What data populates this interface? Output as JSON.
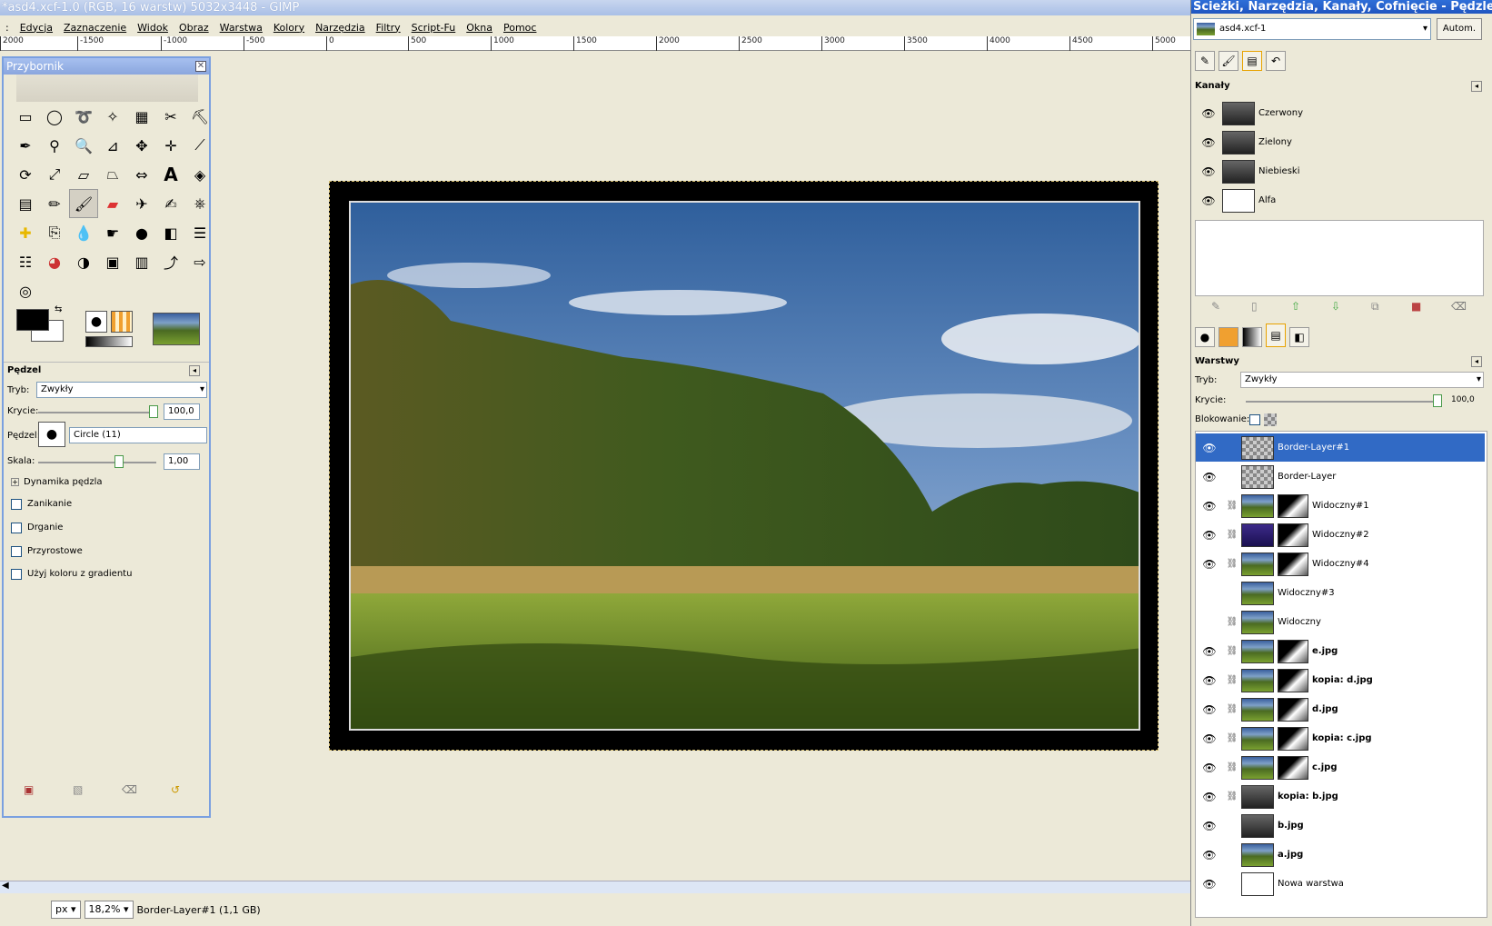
{
  "window": {
    "title": "*asd4.xcf-1.0 (RGB, 16 warstw) 5032x3448 - GIMP"
  },
  "menu": [
    "Edycja",
    "Zaznaczenie",
    "Widok",
    "Obraz",
    "Warstwa",
    "Kolory",
    "Narzędzia",
    "Filtry",
    "Script-Fu",
    "Okna",
    "Pomoc"
  ],
  "ruler": [
    "2000",
    "-1500",
    "-1000",
    "-500",
    "0",
    "500",
    "1000",
    "1500",
    "2000",
    "2500",
    "3000",
    "3500",
    "4000",
    "4500",
    "5000"
  ],
  "status": {
    "unit": "px",
    "zoom": "18,2%",
    "layer_info": "Border-Layer#1 (1,1 GB)"
  },
  "toolbox": {
    "title": "Przybornik",
    "tool_options_title": "Pędzel",
    "mode_label": "Tryb:",
    "mode_value": "Zwykły",
    "opacity_label": "Krycie:",
    "opacity_value": "100,0",
    "brush_label": "Pędzel:",
    "brush_value": "Circle (11)",
    "scale_label": "Skala:",
    "scale_value": "1,00",
    "dynamics_label": "Dynamika pędzla",
    "options": [
      "Zanikanie",
      "Drganie",
      "Przyrostowe",
      "Użyj koloru z gradientu"
    ]
  },
  "dock": {
    "title": "Ścieżki, Narzędzia, Kanały, Cofnięcie - Pędzle, Desenie...",
    "image_select": "asd4.xcf-1",
    "auto_button": "Autom.",
    "channels_title": "Kanały",
    "channels": [
      "Czerwony",
      "Zielony",
      "Niebieski",
      "Alfa"
    ],
    "layers_title": "Warstwy",
    "mode_label": "Tryb:",
    "mode_value": "Zwykły",
    "opacity_label": "Krycie:",
    "opacity_value": "100,0",
    "lock_label": "Blokowanie:",
    "layers": [
      {
        "name": "Border-Layer#1",
        "eye": true,
        "chain": false,
        "thumb": "chk",
        "mask": false,
        "bold": false
      },
      {
        "name": "Border-Layer",
        "eye": true,
        "chain": false,
        "thumb": "chk",
        "mask": false,
        "bold": false
      },
      {
        "name": "Widoczny#1",
        "eye": true,
        "chain": true,
        "thumb": "land",
        "mask": true,
        "bold": false
      },
      {
        "name": "Widoczny#2",
        "eye": true,
        "chain": true,
        "thumb": "purple",
        "mask": true,
        "bold": false
      },
      {
        "name": "Widoczny#4",
        "eye": true,
        "chain": true,
        "thumb": "land",
        "mask": true,
        "bold": false
      },
      {
        "name": "Widoczny#3",
        "eye": false,
        "chain": false,
        "thumb": "land",
        "mask": false,
        "bold": false
      },
      {
        "name": "Widoczny",
        "eye": false,
        "chain": true,
        "thumb": "land",
        "mask": false,
        "bold": false
      },
      {
        "name": "e.jpg",
        "eye": true,
        "chain": true,
        "thumb": "land",
        "mask": true,
        "bold": true
      },
      {
        "name": "kopia: d.jpg",
        "eye": true,
        "chain": true,
        "thumb": "land",
        "mask": true,
        "bold": true
      },
      {
        "name": "d.jpg",
        "eye": true,
        "chain": true,
        "thumb": "land",
        "mask": true,
        "bold": true
      },
      {
        "name": "kopia: c.jpg",
        "eye": true,
        "chain": true,
        "thumb": "land",
        "mask": true,
        "bold": true
      },
      {
        "name": "c.jpg",
        "eye": true,
        "chain": true,
        "thumb": "land",
        "mask": true,
        "bold": true
      },
      {
        "name": "kopia: b.jpg",
        "eye": true,
        "chain": true,
        "thumb": "gray",
        "mask": false,
        "bold": true
      },
      {
        "name": "b.jpg",
        "eye": true,
        "chain": false,
        "thumb": "gray",
        "mask": false,
        "bold": true
      },
      {
        "name": "a.jpg",
        "eye": true,
        "chain": false,
        "thumb": "land",
        "mask": false,
        "bold": true
      },
      {
        "name": "Nowa warstwa",
        "eye": true,
        "chain": false,
        "thumb": "white",
        "mask": false,
        "bold": false
      }
    ]
  }
}
